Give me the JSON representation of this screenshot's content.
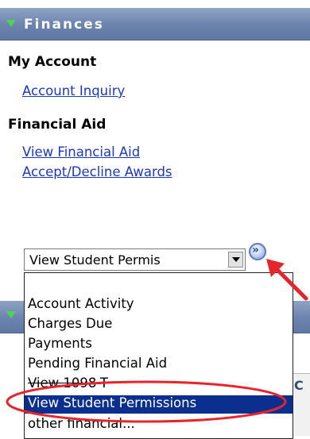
{
  "finances_pagelet": {
    "title": "Finances",
    "sections": {
      "my_account": {
        "heading": "My Account",
        "links": [
          "Account Inquiry"
        ]
      },
      "financial_aid": {
        "heading": "Financial Aid",
        "links": [
          "View Financial Aid",
          "Accept/Decline Awards"
        ]
      }
    }
  },
  "other_financial_select": {
    "value": "View Student Permis",
    "go_button_glyph": "»",
    "options": [
      "",
      "Account Activity",
      "Charges Due",
      "Payments",
      "Pending Financial Aid",
      "View 1098-T",
      "View Student Permissions",
      "other financial..."
    ],
    "selected_index": 6
  },
  "background_box": {
    "label": "C"
  },
  "colors": {
    "header_blue": "#6b83ad",
    "header_triangle": "#4dd35a",
    "link_blue": "#1a38c4",
    "selected_bg": "#0b2f8f",
    "annotation_red": "#e5242b"
  },
  "icons": {
    "header_toggle": "triangle-down-icon",
    "go_button": "double-chevron-right-icon",
    "select_arrow": "chevron-down-icon",
    "annotation": "red-arrow-icon"
  }
}
